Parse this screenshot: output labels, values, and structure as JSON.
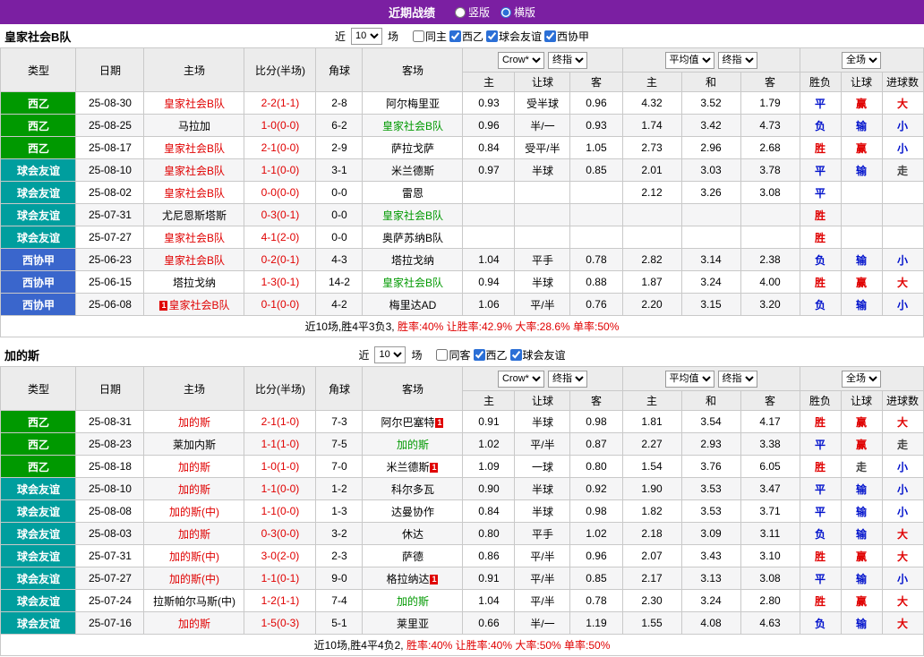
{
  "topbar": {
    "title": "近期战绩",
    "radios": [
      {
        "label": "竖版",
        "selected": false
      },
      {
        "label": "横版",
        "selected": true
      }
    ]
  },
  "colors": {
    "topbar_bg": "#7b1fa2",
    "league_green": "#009900",
    "league_teal": "#009e9e",
    "league_blue": "#3a66cc",
    "text_red": "#e00000",
    "text_blue": "#0011cc",
    "text_green": "#009900",
    "text_dark": "#444444"
  },
  "tables": [
    {
      "team": "皇家社会B队",
      "filter": {
        "near": "近",
        "count": "10",
        "games": "场",
        "checkboxes": [
          {
            "label": "同主",
            "checked": false
          },
          {
            "label": "西乙",
            "checked": true
          },
          {
            "label": "球会友谊",
            "checked": true
          },
          {
            "label": "西协甲",
            "checked": true
          }
        ]
      },
      "header": {
        "cols": [
          "类型",
          "日期",
          "主场",
          "比分(半场)",
          "角球",
          "客场"
        ],
        "odds_company": "Crow*",
        "odds_time": "终指",
        "avg_label": "平均值",
        "avg_time": "终指",
        "full_label": "全场",
        "sub_odds": [
          "主",
          "让球",
          "客"
        ],
        "sub_avg": [
          "主",
          "和",
          "客"
        ],
        "sub_result": [
          "胜负",
          "让球",
          "进球数"
        ]
      },
      "rows": [
        {
          "league": "西乙",
          "league_color": "green",
          "date": "25-08-30",
          "home": "皇家社会B队",
          "home_color": "red",
          "home_badge": "",
          "score": "2-2(1-1)",
          "corner": "2-8",
          "away": "阿尔梅里亚",
          "away_color": "",
          "away_badge": "",
          "odds": [
            "0.93",
            "受半球",
            "0.96"
          ],
          "avg": [
            "4.32",
            "3.52",
            "1.79"
          ],
          "results": [
            [
              "平",
              "blue"
            ],
            [
              "赢",
              "red"
            ],
            [
              "大",
              "red"
            ]
          ]
        },
        {
          "league": "西乙",
          "league_color": "green",
          "date": "25-08-25",
          "home": "马拉加",
          "home_color": "",
          "home_badge": "",
          "score": "1-0(0-0)",
          "corner": "6-2",
          "away": "皇家社会B队",
          "away_color": "green",
          "away_badge": "",
          "odds": [
            "0.96",
            "半/一",
            "0.93"
          ],
          "avg": [
            "1.74",
            "3.42",
            "4.73"
          ],
          "results": [
            [
              "负",
              "blue"
            ],
            [
              "输",
              "blue"
            ],
            [
              "小",
              "blue"
            ]
          ]
        },
        {
          "league": "西乙",
          "league_color": "green",
          "date": "25-08-17",
          "home": "皇家社会B队",
          "home_color": "red",
          "home_badge": "",
          "score": "2-1(0-0)",
          "corner": "2-9",
          "away": "萨拉戈萨",
          "away_color": "",
          "away_badge": "",
          "odds": [
            "0.84",
            "受平/半",
            "1.05"
          ],
          "avg": [
            "2.73",
            "2.96",
            "2.68"
          ],
          "results": [
            [
              "胜",
              "red"
            ],
            [
              "赢",
              "red"
            ],
            [
              "小",
              "blue"
            ]
          ]
        },
        {
          "league": "球会友谊",
          "league_color": "teal",
          "date": "25-08-10",
          "home": "皇家社会B队",
          "home_color": "red",
          "home_badge": "",
          "score": "1-1(0-0)",
          "corner": "3-1",
          "away": "米兰德斯",
          "away_color": "",
          "away_badge": "",
          "odds": [
            "0.97",
            "半球",
            "0.85"
          ],
          "avg": [
            "2.01",
            "3.03",
            "3.78"
          ],
          "results": [
            [
              "平",
              "blue"
            ],
            [
              "输",
              "blue"
            ],
            [
              "走",
              "dark"
            ]
          ]
        },
        {
          "league": "球会友谊",
          "league_color": "teal",
          "date": "25-08-02",
          "home": "皇家社会B队",
          "home_color": "red",
          "home_badge": "",
          "score": "0-0(0-0)",
          "corner": "0-0",
          "away": "雷恩",
          "away_color": "",
          "away_badge": "",
          "odds": [
            "",
            "",
            ""
          ],
          "avg": [
            "2.12",
            "3.26",
            "3.08"
          ],
          "results": [
            [
              "平",
              "blue"
            ],
            [
              "",
              ""
            ],
            [
              "",
              ""
            ]
          ]
        },
        {
          "league": "球会友谊",
          "league_color": "teal",
          "date": "25-07-31",
          "home": "尤尼恩斯塔斯",
          "home_color": "",
          "home_badge": "",
          "score": "0-3(0-1)",
          "corner": "0-0",
          "away": "皇家社会B队",
          "away_color": "green",
          "away_badge": "",
          "odds": [
            "",
            "",
            ""
          ],
          "avg": [
            "",
            "",
            ""
          ],
          "results": [
            [
              "胜",
              "red"
            ],
            [
              "",
              ""
            ],
            [
              "",
              ""
            ]
          ]
        },
        {
          "league": "球会友谊",
          "league_color": "teal",
          "date": "25-07-27",
          "home": "皇家社会B队",
          "home_color": "red",
          "home_badge": "",
          "score": "4-1(2-0)",
          "corner": "0-0",
          "away": "奥萨苏纳B队",
          "away_color": "",
          "away_badge": "",
          "odds": [
            "",
            "",
            ""
          ],
          "avg": [
            "",
            "",
            ""
          ],
          "results": [
            [
              "胜",
              "red"
            ],
            [
              "",
              ""
            ],
            [
              "",
              ""
            ]
          ]
        },
        {
          "league": "西协甲",
          "league_color": "blue",
          "date": "25-06-23",
          "home": "皇家社会B队",
          "home_color": "red",
          "home_badge": "",
          "score": "0-2(0-1)",
          "corner": "4-3",
          "away": "塔拉戈纳",
          "away_color": "",
          "away_badge": "",
          "odds": [
            "1.04",
            "平手",
            "0.78"
          ],
          "avg": [
            "2.82",
            "3.14",
            "2.38"
          ],
          "results": [
            [
              "负",
              "blue"
            ],
            [
              "输",
              "blue"
            ],
            [
              "小",
              "blue"
            ]
          ]
        },
        {
          "league": "西协甲",
          "league_color": "blue",
          "date": "25-06-15",
          "home": "塔拉戈纳",
          "home_color": "",
          "home_badge": "",
          "score": "1-3(0-1)",
          "corner": "14-2",
          "away": "皇家社会B队",
          "away_color": "green",
          "away_badge": "",
          "odds": [
            "0.94",
            "半球",
            "0.88"
          ],
          "avg": [
            "1.87",
            "3.24",
            "4.00"
          ],
          "results": [
            [
              "胜",
              "red"
            ],
            [
              "赢",
              "red"
            ],
            [
              "大",
              "red"
            ]
          ]
        },
        {
          "league": "西协甲",
          "league_color": "blue",
          "date": "25-06-08",
          "home": "皇家社会B队",
          "home_color": "red",
          "home_badge": "1",
          "score": "0-1(0-0)",
          "corner": "4-2",
          "away": "梅里达AD",
          "away_color": "",
          "away_badge": "",
          "odds": [
            "1.06",
            "平/半",
            "0.76"
          ],
          "avg": [
            "2.20",
            "3.15",
            "3.20"
          ],
          "results": [
            [
              "负",
              "blue"
            ],
            [
              "输",
              "blue"
            ],
            [
              "小",
              "blue"
            ]
          ]
        }
      ],
      "summary_prefix": "近10场,胜4平3负3,",
      "summary_stats": "胜率:40% 让胜率:42.9% 大率:28.6% 单率:50%"
    },
    {
      "team": "加的斯",
      "filter": {
        "near": "近",
        "count": "10",
        "games": "场",
        "checkboxes": [
          {
            "label": "同客",
            "checked": false
          },
          {
            "label": "西乙",
            "checked": true
          },
          {
            "label": "球会友谊",
            "checked": true
          }
        ]
      },
      "header": {
        "cols": [
          "类型",
          "日期",
          "主场",
          "比分(半场)",
          "角球",
          "客场"
        ],
        "odds_company": "Crow*",
        "odds_time": "终指",
        "avg_label": "平均值",
        "avg_time": "终指",
        "full_label": "全场",
        "sub_odds": [
          "主",
          "让球",
          "客"
        ],
        "sub_avg": [
          "主",
          "和",
          "客"
        ],
        "sub_result": [
          "胜负",
          "让球",
          "进球数"
        ]
      },
      "rows": [
        {
          "league": "西乙",
          "league_color": "green",
          "date": "25-08-31",
          "home": "加的斯",
          "home_color": "red",
          "home_badge": "",
          "score": "2-1(1-0)",
          "corner": "7-3",
          "away": "阿尔巴塞特",
          "away_color": "",
          "away_badge": "1",
          "odds": [
            "0.91",
            "半球",
            "0.98"
          ],
          "avg": [
            "1.81",
            "3.54",
            "4.17"
          ],
          "results": [
            [
              "胜",
              "red"
            ],
            [
              "赢",
              "red"
            ],
            [
              "大",
              "red"
            ]
          ]
        },
        {
          "league": "西乙",
          "league_color": "green",
          "date": "25-08-23",
          "home": "莱加内斯",
          "home_color": "",
          "home_badge": "",
          "score": "1-1(1-0)",
          "corner": "7-5",
          "away": "加的斯",
          "away_color": "green",
          "away_badge": "",
          "odds": [
            "1.02",
            "平/半",
            "0.87"
          ],
          "avg": [
            "2.27",
            "2.93",
            "3.38"
          ],
          "results": [
            [
              "平",
              "blue"
            ],
            [
              "赢",
              "red"
            ],
            [
              "走",
              "dark"
            ]
          ]
        },
        {
          "league": "西乙",
          "league_color": "green",
          "date": "25-08-18",
          "home": "加的斯",
          "home_color": "red",
          "home_badge": "",
          "score": "1-0(1-0)",
          "corner": "7-0",
          "away": "米兰德斯",
          "away_color": "",
          "away_badge": "1",
          "odds": [
            "1.09",
            "一球",
            "0.80"
          ],
          "avg": [
            "1.54",
            "3.76",
            "6.05"
          ],
          "results": [
            [
              "胜",
              "red"
            ],
            [
              "走",
              "dark"
            ],
            [
              "小",
              "blue"
            ]
          ]
        },
        {
          "league": "球会友谊",
          "league_color": "teal",
          "date": "25-08-10",
          "home": "加的斯",
          "home_color": "red",
          "home_badge": "",
          "score": "1-1(0-0)",
          "corner": "1-2",
          "away": "科尔多瓦",
          "away_color": "",
          "away_badge": "",
          "odds": [
            "0.90",
            "半球",
            "0.92"
          ],
          "avg": [
            "1.90",
            "3.53",
            "3.47"
          ],
          "results": [
            [
              "平",
              "blue"
            ],
            [
              "输",
              "blue"
            ],
            [
              "小",
              "blue"
            ]
          ]
        },
        {
          "league": "球会友谊",
          "league_color": "teal",
          "date": "25-08-08",
          "home": "加的斯(中)",
          "home_color": "red",
          "home_badge": "",
          "score": "1-1(0-0)",
          "corner": "1-3",
          "away": "达曼协作",
          "away_color": "",
          "away_badge": "",
          "odds": [
            "0.84",
            "半球",
            "0.98"
          ],
          "avg": [
            "1.82",
            "3.53",
            "3.71"
          ],
          "results": [
            [
              "平",
              "blue"
            ],
            [
              "输",
              "blue"
            ],
            [
              "小",
              "blue"
            ]
          ]
        },
        {
          "league": "球会友谊",
          "league_color": "teal",
          "date": "25-08-03",
          "home": "加的斯",
          "home_color": "red",
          "home_badge": "",
          "score": "0-3(0-0)",
          "corner": "3-2",
          "away": "休达",
          "away_color": "",
          "away_badge": "",
          "odds": [
            "0.80",
            "平手",
            "1.02"
          ],
          "avg": [
            "2.18",
            "3.09",
            "3.11"
          ],
          "results": [
            [
              "负",
              "blue"
            ],
            [
              "输",
              "blue"
            ],
            [
              "大",
              "red"
            ]
          ]
        },
        {
          "league": "球会友谊",
          "league_color": "teal",
          "date": "25-07-31",
          "home": "加的斯(中)",
          "home_color": "red",
          "home_badge": "",
          "score": "3-0(2-0)",
          "corner": "2-3",
          "away": "萨德",
          "away_color": "",
          "away_badge": "",
          "odds": [
            "0.86",
            "平/半",
            "0.96"
          ],
          "avg": [
            "2.07",
            "3.43",
            "3.10"
          ],
          "results": [
            [
              "胜",
              "red"
            ],
            [
              "赢",
              "red"
            ],
            [
              "大",
              "red"
            ]
          ]
        },
        {
          "league": "球会友谊",
          "league_color": "teal",
          "date": "25-07-27",
          "home": "加的斯(中)",
          "home_color": "red",
          "home_badge": "",
          "score": "1-1(0-1)",
          "corner": "9-0",
          "away": "格拉纳达",
          "away_color": "",
          "away_badge": "1",
          "odds": [
            "0.91",
            "平/半",
            "0.85"
          ],
          "avg": [
            "2.17",
            "3.13",
            "3.08"
          ],
          "results": [
            [
              "平",
              "blue"
            ],
            [
              "输",
              "blue"
            ],
            [
              "小",
              "blue"
            ]
          ]
        },
        {
          "league": "球会友谊",
          "league_color": "teal",
          "date": "25-07-24",
          "home": "拉斯帕尔马斯(中)",
          "home_color": "",
          "home_badge": "",
          "score": "1-2(1-1)",
          "corner": "7-4",
          "away": "加的斯",
          "away_color": "green",
          "away_badge": "",
          "odds": [
            "1.04",
            "平/半",
            "0.78"
          ],
          "avg": [
            "2.30",
            "3.24",
            "2.80"
          ],
          "results": [
            [
              "胜",
              "red"
            ],
            [
              "赢",
              "red"
            ],
            [
              "大",
              "red"
            ]
          ]
        },
        {
          "league": "球会友谊",
          "league_color": "teal",
          "date": "25-07-16",
          "home": "加的斯",
          "home_color": "red",
          "home_badge": "",
          "score": "1-5(0-3)",
          "corner": "5-1",
          "away": "莱里亚",
          "away_color": "",
          "away_badge": "",
          "odds": [
            "0.66",
            "半/一",
            "1.19"
          ],
          "avg": [
            "1.55",
            "4.08",
            "4.63"
          ],
          "results": [
            [
              "负",
              "blue"
            ],
            [
              "输",
              "blue"
            ],
            [
              "大",
              "red"
            ]
          ]
        }
      ],
      "summary_prefix": "近10场,胜4平4负2,",
      "summary_stats": "胜率:40% 让胜率:40% 大率:50% 单率:50%"
    }
  ]
}
